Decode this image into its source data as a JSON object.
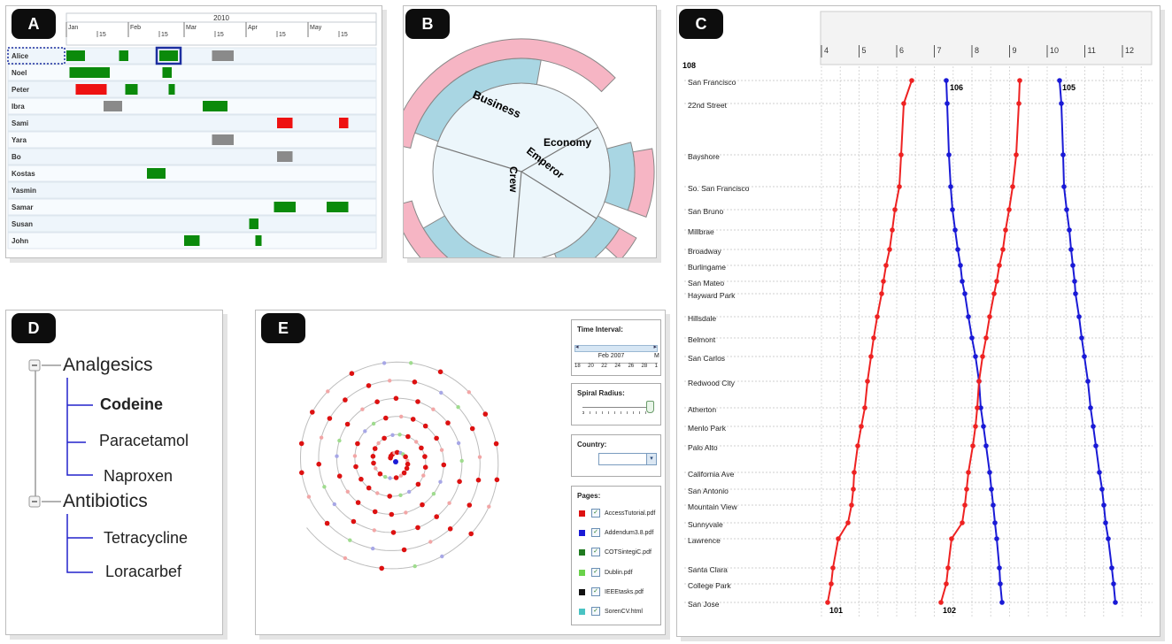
{
  "panels": {
    "a": {
      "badge": "A",
      "year": "2010",
      "months": [
        "Jan",
        "Feb",
        "Mar",
        "Apr",
        "May"
      ],
      "mid_tick": "15",
      "rows": [
        "Alice",
        "Noel",
        "Peter",
        "Ibra",
        "Sami",
        "Yara",
        "Bo",
        "Kostas",
        "Yasmin",
        "Samar",
        "Susan",
        "John"
      ],
      "colors": {
        "green": "#0b8a0b",
        "red": "#ee1111",
        "gray": "#8a8a8a",
        "selected_border": "#1d2fa0"
      }
    },
    "b": {
      "badge": "B",
      "labels": [
        "Business",
        "Crew",
        "Emperor",
        "Economy"
      ],
      "colors": {
        "inner": "#ecf6fb",
        "blue_ring": "#a9d6e3",
        "pink_ring": "#f6b5c4"
      }
    },
    "c": {
      "badge": "C",
      "x_ticks": [
        "4",
        "5",
        "6",
        "7",
        "8",
        "9",
        "10",
        "11",
        "12"
      ],
      "route_labels": {
        "top_left": "108",
        "blue_left_top": "106",
        "blue_right_top": "105",
        "red_left_bottom": "101",
        "red_right_bottom": "102"
      },
      "stations": [
        "San Francisco",
        "22nd Street",
        "Bayshore",
        "So. San Francisco",
        "San Bruno",
        "Millbrae",
        "Broadway",
        "Burlingame",
        "San Mateo",
        "Hayward Park",
        "Hillsdale",
        "Belmont",
        "San Carlos",
        "Redwood City",
        "Atherton",
        "Menlo Park",
        "Palo Alto",
        "California Ave",
        "San Antonio",
        "Mountain View",
        "Sunnyvale",
        "Lawrence",
        "Santa Clara",
        "College Park",
        "San Jose"
      ],
      "colors": {
        "red": "#ee2222",
        "blue": "#1a1ad6"
      }
    },
    "d": {
      "badge": "D",
      "tree": [
        {
          "label": "Analgesics",
          "children": [
            "Codeine",
            "Paracetamol",
            "Naproxen"
          ]
        },
        {
          "label": "Antibiotics",
          "children": [
            "Tetracycline",
            "Loracarbef"
          ]
        }
      ],
      "selected": "Codeine"
    },
    "e": {
      "badge": "E",
      "time_interval": {
        "title": "Time Interval:",
        "month": "Feb 2007",
        "days": [
          "18",
          "20",
          "22",
          "24",
          "26",
          "28",
          "1"
        ],
        "next_label": "M"
      },
      "spiral_radius": {
        "title": "Spiral Radius:"
      },
      "country": {
        "title": "Country:",
        "value": ""
      },
      "pages": {
        "title": "Pages:",
        "items": [
          {
            "name": "AccessTutorial.pdf",
            "color": "#dd1111"
          },
          {
            "name": "Addendum3.8.pdf",
            "color": "#1a1ad6"
          },
          {
            "name": "COTSintegiC.pdf",
            "color": "#1f7a1f"
          },
          {
            "name": "Dublin.pdf",
            "color": "#6ad24a"
          },
          {
            "name": "IEEEtasks.pdf",
            "color": "#111111"
          },
          {
            "name": "SorenCV.html",
            "color": "#49c3c3"
          }
        ]
      }
    }
  }
}
